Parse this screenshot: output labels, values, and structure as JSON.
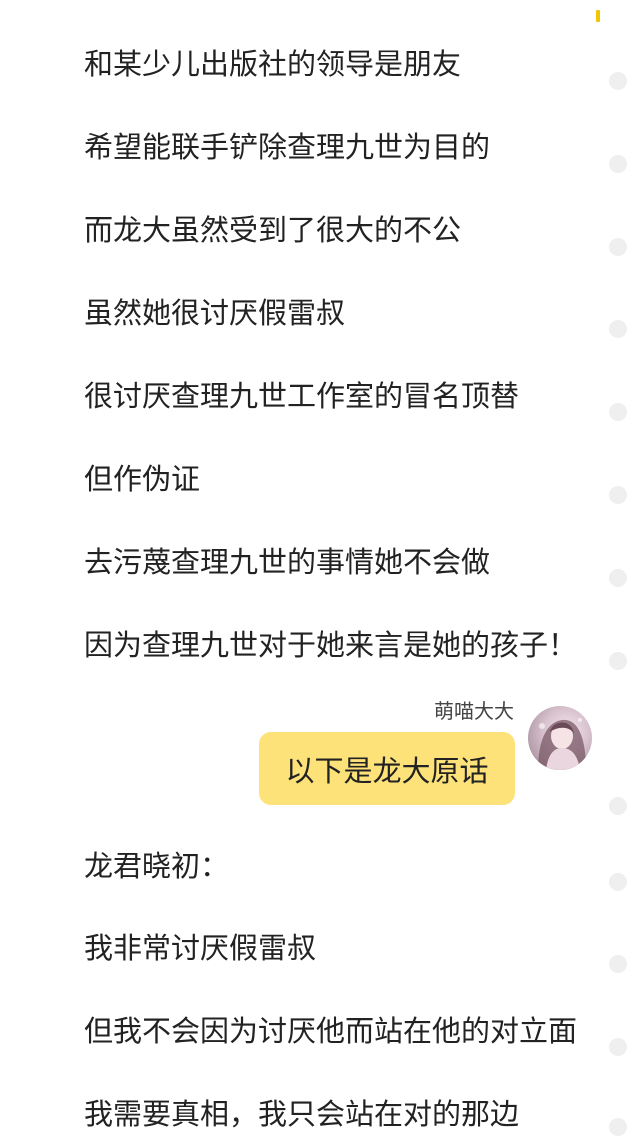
{
  "colors": {
    "accent": "#f5c400",
    "bubble": "#fde27a",
    "dot": "#efefef",
    "text": "#222222"
  },
  "lines_before": [
    "和某少儿出版社的领导是朋友",
    "希望能联手铲除查理九世为目的",
    "而龙大虽然受到了很大的不公",
    "虽然她很讨厌假雷叔",
    "很讨厌查理九世工作室的冒名顶替",
    "但作伪证",
    "去污蔑查理九世的事情她不会做",
    "因为查理九世对于她来言是她的孩子！"
  ],
  "chat": {
    "sender_name": "萌喵大大",
    "message": "以下是龙大原话",
    "avatar_icon": "avatar-girl-illustration"
  },
  "lines_after": [
    "龙君晓初：",
    "我非常讨厌假雷叔",
    "但我不会因为讨厌他而站在他的对立面",
    "我需要真相，我只会站在对的那边"
  ]
}
